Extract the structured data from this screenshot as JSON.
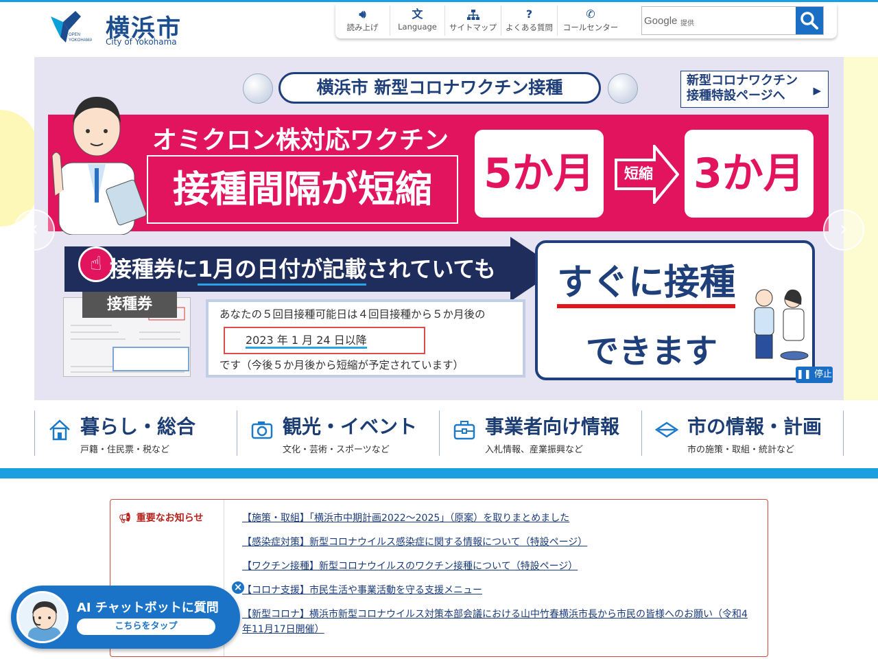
{
  "header": {
    "logo_mark_text": "OPEN YOKOHAMA",
    "city_name": "横浜市",
    "city_name_en": "City of Yokohama",
    "tools": [
      {
        "label": "読み上げ",
        "icon": "speaker-icon"
      },
      {
        "label": "Language",
        "icon": "language-icon"
      },
      {
        "label": "サイトマップ",
        "icon": "sitemap-icon"
      },
      {
        "label": "よくある質問",
        "icon": "question-icon"
      },
      {
        "label": "コールセンター",
        "icon": "phone-icon"
      }
    ],
    "search": {
      "google_label": "Google",
      "provided": "提供",
      "placeholder": ""
    }
  },
  "banner": {
    "vaccine_title": "横浜市 新型コロナワクチン接種",
    "special_page": "新型コロナワクチン\n接種特設ページへ",
    "omicron_headline": "オミクロン株対応ワクチン",
    "interval_headline": "接種間隔が短縮",
    "from_months": "5か月",
    "short_label": "短縮",
    "to_months": "3か月",
    "ticket_notice_pre": "接種券に",
    "ticket_notice_mid": "1月の日付が記載",
    "ticket_notice_post": "されていても",
    "ticket_label": "接種券",
    "info_line1": "あなたの５回目接種可能日は４回目接種から５か月後の",
    "info_date": "2023 年 1 月 24 日以降",
    "info_line3": "です（今後５か月後から短縮が予定されています）",
    "soon_line1": "すぐに接種",
    "soon_line2": "できます",
    "pause_label": "停止",
    "prev_label": "‹",
    "next_label": "›"
  },
  "categories": [
    {
      "name": "暮らし・総合",
      "sub": "戸籍・住民票・税など",
      "icon": "house-icon"
    },
    {
      "name": "観光・イベント",
      "sub": "文化・芸術・スポーツなど",
      "icon": "camera-icon"
    },
    {
      "name": "事業者向け情報",
      "sub": "入札情報、産業振興など",
      "icon": "briefcase-icon"
    },
    {
      "name": "市の情報・計画",
      "sub": "市の施策・取組・統計など",
      "icon": "layers-icon"
    }
  ],
  "notice": {
    "title": "重要なお知らせ",
    "items": [
      "【施策・取組】「横浜市中期計画2022～2025」（原案）を取りまとめました",
      "【感染症対策】新型コロナウイルス感染症に関する情報について（特設ページ）",
      "【ワクチン接種】新型コロナウイルスのワクチン接種について（特設ページ）",
      "【コロナ支援】市民生活や事業活動を守る支援メニュー",
      "【新型コロナ】横浜市新型コロナウイルス対策本部会議における山中竹春横浜市長から市民の皆様へのお願い（令和4年11月17日開催）"
    ]
  },
  "chatbot": {
    "title": "AI チャットボットに質問",
    "tap": "こちらをタップ",
    "close": "×"
  },
  "colors": {
    "accent_blue": "#1aa0e0",
    "brand_navy": "#1f3f7a",
    "banner_pink": "#e2145e",
    "notice_red": "#b8221b"
  }
}
